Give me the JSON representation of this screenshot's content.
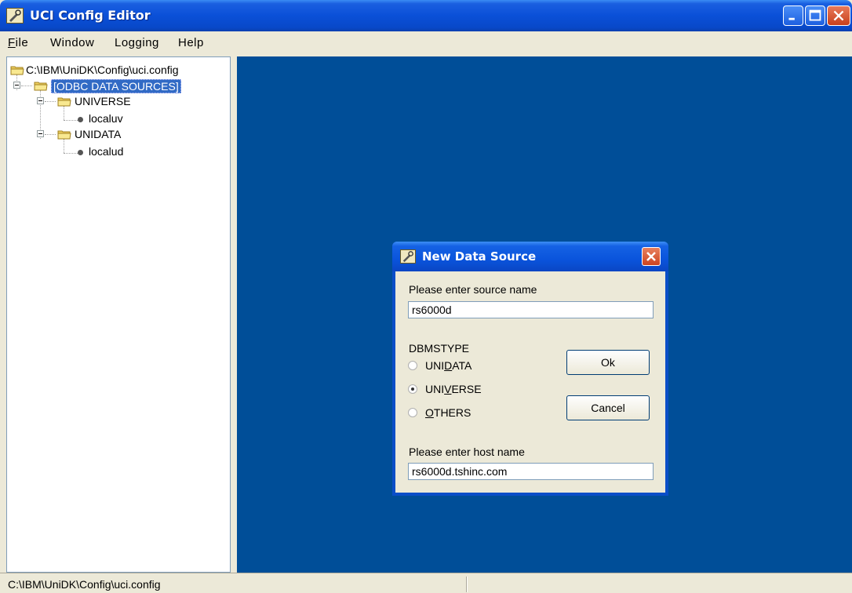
{
  "window": {
    "title": "UCI Config Editor"
  },
  "menu": [
    {
      "label": "File",
      "underline": "F",
      "rest": "ile"
    },
    {
      "label": "Window"
    },
    {
      "label": "Logging"
    },
    {
      "label": "Help"
    }
  ],
  "tree": {
    "root": "C:\\IBM\\UniDK\\Config\\uci.config",
    "group": "[ODBC DATA SOURCES]",
    "children": [
      {
        "label": "UNIVERSE",
        "child": "localuv"
      },
      {
        "label": "UNIDATA",
        "child": "localud"
      }
    ]
  },
  "dialog": {
    "title": "New Data Source",
    "source_label": "Please enter source name",
    "source_value": "rs6000d",
    "dbms_label": "DBMSTYPE",
    "radios": [
      {
        "pre": "UNI",
        "u": "D",
        "post": "ATA",
        "checked": false
      },
      {
        "pre": "UNI",
        "u": "V",
        "post": "ERSE",
        "checked": true
      },
      {
        "pre": "",
        "u": "O",
        "post": "THERS",
        "checked": false
      }
    ],
    "ok_label": "Ok",
    "cancel_label": "Cancel",
    "host_label": "Please enter host name",
    "host_value": "rs6000d.tshinc.com"
  },
  "status": {
    "path": "C:\\IBM\\UniDK\\Config\\uci.config"
  },
  "colors": {
    "desktop": "#004e98",
    "selection": "#316ac5",
    "titlebar": "#0a50d8"
  }
}
